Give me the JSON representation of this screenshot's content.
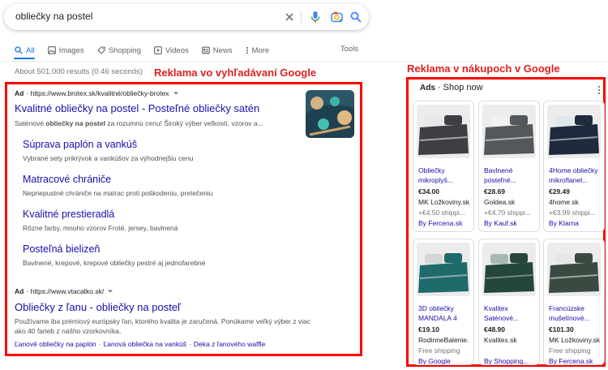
{
  "search": {
    "query": "obliečky na postel"
  },
  "tabs": [
    {
      "label": "All",
      "icon": "search-icon"
    },
    {
      "label": "Images",
      "icon": "image-icon"
    },
    {
      "label": "Shopping",
      "icon": "tag-icon"
    },
    {
      "label": "Videos",
      "icon": "video-icon"
    },
    {
      "label": "News",
      "icon": "news-icon"
    },
    {
      "label": "More",
      "icon": "more-dots-icon"
    }
  ],
  "tools_label": "Tools",
  "results_count": "About 501,000 results (0.46 seconds)",
  "annotations": {
    "left": "Reklama vo vyhľadávaní Google",
    "right": "Reklama v nákupoch v Google"
  },
  "ad1": {
    "ad_label": "Ad",
    "url": "· https://www.brotex.sk/kvalitné/obliečky-brotex",
    "title": "Kvalitné obliečky na postel - Posteľné obliečky satén",
    "desc_pre": "Saténové ",
    "desc_bold": "obliečky na postel",
    "desc_post": " za rozumnú cenu! Široký výber veľkostí, vzorov a...",
    "sitelinks": [
      {
        "title": "Súprava paplón a vankúš",
        "desc": "Vybrané sety prikrývok a vankúšov za výhodnejšiu cenu"
      },
      {
        "title": "Matracové chrániče",
        "desc": "Nepriepustné chrániče na matrac proti poškodeniu, pretečeniu"
      },
      {
        "title": "Kvalitné prestieradlá",
        "desc": "Rôzne farby, mnoho vzorov Froté, jersey, bavlnená"
      },
      {
        "title": "Posteľná bielizeň",
        "desc": "Bavlnené, krepové, krepové obliečky pestré aj jednofarebné"
      }
    ]
  },
  "ad2": {
    "ad_label": "Ad",
    "url": "· https://www.vtacatko.sk/",
    "title": "Obliečky z ľanu - obliečky na posteľ",
    "desc": "Používame iba prémiový európsky ľan, ktorého kvalita je zaručená. Ponúkame veľký výber z viac ako 40 farieb z nášho vzorkovníka.",
    "links": [
      "Ľanové obliečky na paplón",
      "Ľanová obliečka na vankúš",
      "Deka z ľanového waffle"
    ]
  },
  "shopping": {
    "ads_label": "Ads",
    "heading": "· Shop now",
    "products": [
      {
        "title": "Obliečky mikroplyš...",
        "price": "€34.00",
        "store": "MK Ložkoviny.sk",
        "ship": "+€4.50 shippi...",
        "by": "By Fercena.sk",
        "colors": [
          "#3d3f45",
          "#e7e7e9"
        ]
      },
      {
        "title": "Bavlnené posteľné...",
        "price": "€28.69",
        "store": "Goldea.sk",
        "ship": "+€4.70 shippi...",
        "by": "By Kauf.sk",
        "colors": [
          "#54585c",
          "#f2f2f2"
        ]
      },
      {
        "title": "4Home obliečky mikroflanel...",
        "price": "€29.49",
        "store": "4home.sk",
        "ship": "+€3.99 shippi...",
        "by": "By Klarna",
        "colors": [
          "#1f2b3c",
          "#dfe6ee"
        ]
      },
      {
        "title": "3D obliečky MANDALA 4",
        "price": "€19.10",
        "store": "RodinneBalenie.",
        "ship": "Free shipping",
        "by": "By Google",
        "colors": [
          "#1f6a6a",
          "#d2d4d4"
        ]
      },
      {
        "title": "Kvalitex Saténové...",
        "price": "€48.90",
        "store": "Kvalitex.sk",
        "ship": "",
        "by": "By Shopping...",
        "colors": [
          "#25463a",
          "#a4b2ac"
        ]
      },
      {
        "title": "Francúzske mušelínové...",
        "price": "€101.30",
        "store": "MK Ložkoviny.sk",
        "ship": "Free shipping",
        "by": "By Fercena.sk",
        "colors": [
          "#3b4a40",
          "#e6e6e6"
        ]
      }
    ]
  },
  "colors": {
    "link": "#1a0dab",
    "accent": "#1a73e8",
    "annotation": "#e02020",
    "frame": "#ff0000"
  }
}
